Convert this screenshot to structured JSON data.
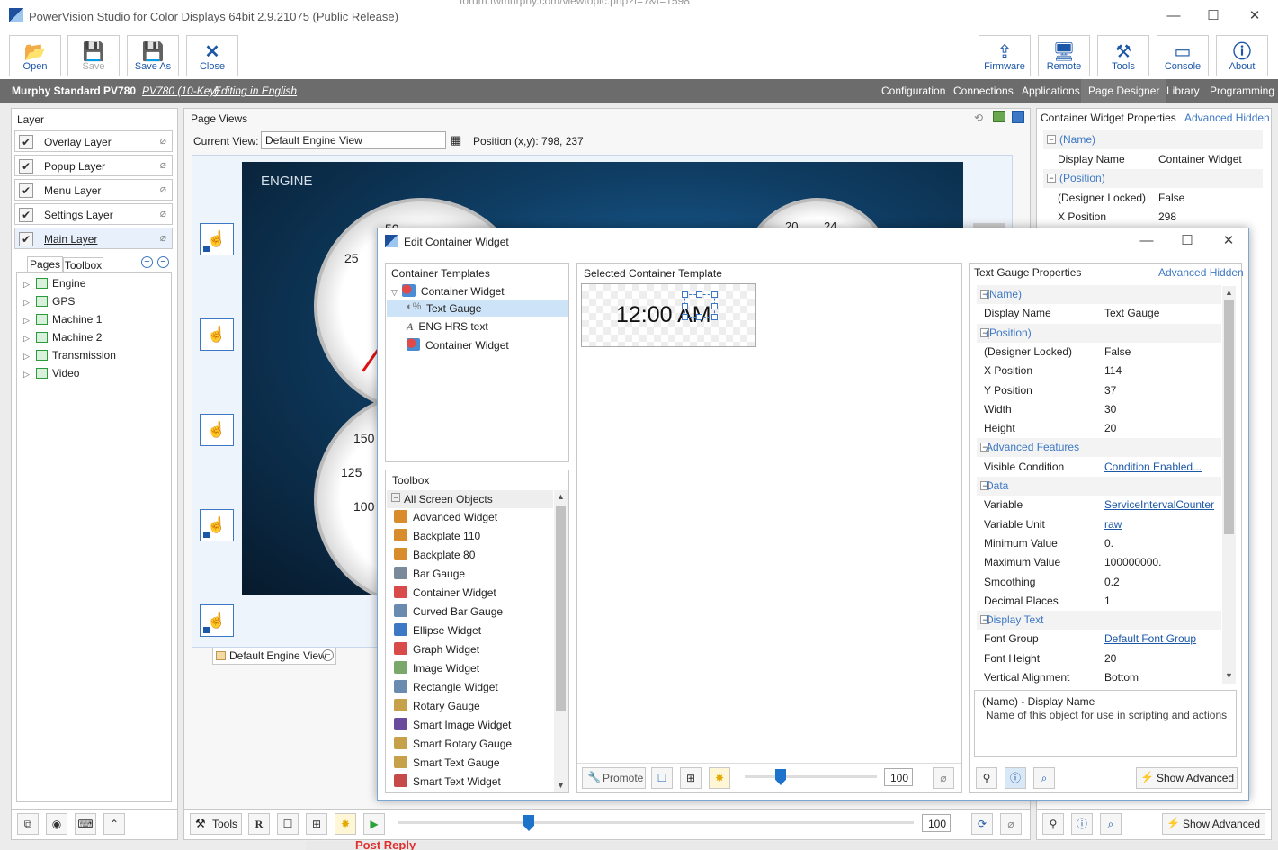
{
  "window": {
    "title": "PowerVision Studio for Color Displays 64bit 2.9.21075 (Public Release)",
    "bg_url": "forum.twmurphy.com/viewtopic.php?f=7&t=1598",
    "bg_bottom": "Post Reply"
  },
  "toolbar": {
    "open": "Open",
    "save": "Save",
    "save_as": "Save As",
    "close": "Close",
    "firmware": "Firmware",
    "remote": "Remote",
    "tools": "Tools",
    "console": "Console",
    "about": "About"
  },
  "menubar": {
    "project": "Murphy Standard PV780",
    "model": "PV780 (10-Key)",
    "editing": "Editing in English",
    "tabs": [
      "Configuration",
      "Connections",
      "Applications",
      "Page Designer",
      "Library",
      "Programming"
    ],
    "active": "Page Designer"
  },
  "layers": {
    "title": "Layer",
    "items": [
      "Overlay Layer",
      "Popup Layer",
      "Menu Layer",
      "Settings Layer",
      "Main Layer"
    ],
    "tab_pages": "Pages",
    "tab_toolbox": "Toolbox",
    "pages": [
      "Engine",
      "GPS",
      "Machine 1",
      "Machine 2",
      "Transmission",
      "Video"
    ]
  },
  "pageviews": {
    "title": "Page Views",
    "current_view_label": "Current View:",
    "current_view": "Default Engine View",
    "position": "Position (x,y): 798, 237",
    "engine_label": "ENGINE",
    "gauge1_ticks": [
      "25",
      "50"
    ],
    "gauge2_ticks": [
      "150",
      "125",
      "100"
    ],
    "gauge3_ticks": [
      "20",
      "24"
    ],
    "view_tab": "Default Engine View",
    "tools": "Tools",
    "zoom": "100"
  },
  "right_props": {
    "title": "Container Widget Properties",
    "advanced": "Advanced Hidden",
    "rows": [
      {
        "k": "(Name)",
        "v": "",
        "sec": true
      },
      {
        "k": "Display Name",
        "v": "Container Widget"
      },
      {
        "k": "(Position)",
        "v": "",
        "sec": true
      },
      {
        "k": "(Designer Locked)",
        "v": "False"
      },
      {
        "k": "X Position",
        "v": "298"
      }
    ],
    "show_advanced": "Show Advanced"
  },
  "dialog": {
    "title": "Edit Container Widget",
    "templates_title": "Container Templates",
    "templates": [
      {
        "label": "Container Widget",
        "level": 0
      },
      {
        "label": "Text Gauge",
        "level": 1,
        "selected": true
      },
      {
        "label": "ENG HRS text",
        "level": 1
      },
      {
        "label": "Container Widget",
        "level": 1
      }
    ],
    "selected_title": "Selected Container Template",
    "preview_text": "12:00 AM",
    "toolbox_title": "Toolbox",
    "toolbox_group": "All Screen Objects",
    "toolbox_items": [
      "Advanced Widget",
      "Backplate 110",
      "Backplate 80",
      "Bar Gauge",
      "Container Widget",
      "Curved Bar Gauge",
      "Ellipse Widget",
      "Graph Widget",
      "Image Widget",
      "Rectangle Widget",
      "Rotary Gauge",
      "Smart Image Widget",
      "Smart Rotary Gauge",
      "Smart Text Gauge",
      "Smart Text Widget"
    ],
    "promote": "Promote",
    "zoom": "100",
    "props_title": "Text Gauge Properties",
    "props_advanced": "Advanced Hidden",
    "props": [
      {
        "k": "(Name)",
        "v": "",
        "sec": true
      },
      {
        "k": "Display Name",
        "v": "Text Gauge"
      },
      {
        "k": "(Position)",
        "v": "",
        "sec": true
      },
      {
        "k": "(Designer Locked)",
        "v": "False"
      },
      {
        "k": "X Position",
        "v": "114"
      },
      {
        "k": "Y Position",
        "v": "37"
      },
      {
        "k": "Width",
        "v": "30"
      },
      {
        "k": "Height",
        "v": "20"
      },
      {
        "k": "Advanced Features",
        "v": "",
        "sec": true
      },
      {
        "k": "Visible Condition",
        "v": "Condition Enabled...",
        "link": true
      },
      {
        "k": "Data",
        "v": "",
        "sec": true
      },
      {
        "k": "Variable",
        "v": "ServiceIntervalCounter",
        "link": true
      },
      {
        "k": "Variable Unit",
        "v": "raw",
        "link": true
      },
      {
        "k": "Minimum Value",
        "v": "0."
      },
      {
        "k": "Maximum Value",
        "v": "100000000."
      },
      {
        "k": "Smoothing",
        "v": "0.2"
      },
      {
        "k": "Decimal Places",
        "v": "1"
      },
      {
        "k": "Display Text",
        "v": "",
        "sec": true
      },
      {
        "k": "Font Group",
        "v": "Default Font Group",
        "link": true
      },
      {
        "k": "Font Height",
        "v": "20"
      },
      {
        "k": "Vertical Alignment",
        "v": "Bottom"
      }
    ],
    "desc_title": "(Name) - Display Name",
    "desc_text": "Name of this object for use in scripting and actions",
    "show_advanced": "Show Advanced"
  }
}
